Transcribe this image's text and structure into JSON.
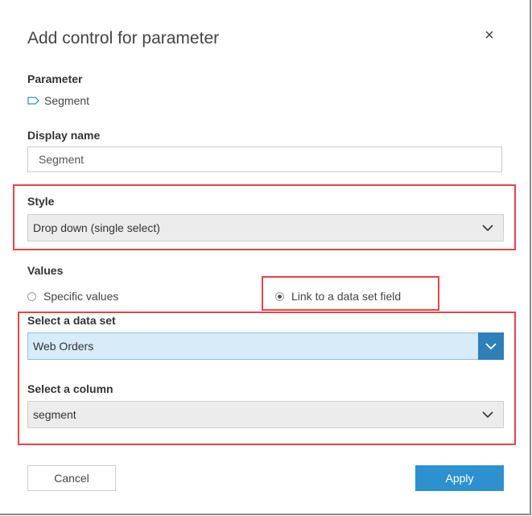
{
  "dialog": {
    "title": "Add control for parameter",
    "close_glyph": "×"
  },
  "parameter": {
    "label": "Parameter",
    "name": "Segment",
    "icon": "parameter-tag-icon"
  },
  "display_name": {
    "label": "Display name",
    "value": "Segment"
  },
  "style": {
    "label": "Style",
    "selected": "Drop down (single select)"
  },
  "values": {
    "label": "Values",
    "options": [
      {
        "label": "Specific values",
        "checked": false
      },
      {
        "label": "Link to a data set field",
        "checked": true
      }
    ]
  },
  "dataset": {
    "label": "Select a data set",
    "selected": "Web Orders"
  },
  "column": {
    "label": "Select a column",
    "selected": "segment"
  },
  "buttons": {
    "cancel": "Cancel",
    "apply": "Apply"
  },
  "colors": {
    "accent": "#2e91cf",
    "highlight": "#e7434b",
    "active_select_bg": "#d7ebf8"
  }
}
